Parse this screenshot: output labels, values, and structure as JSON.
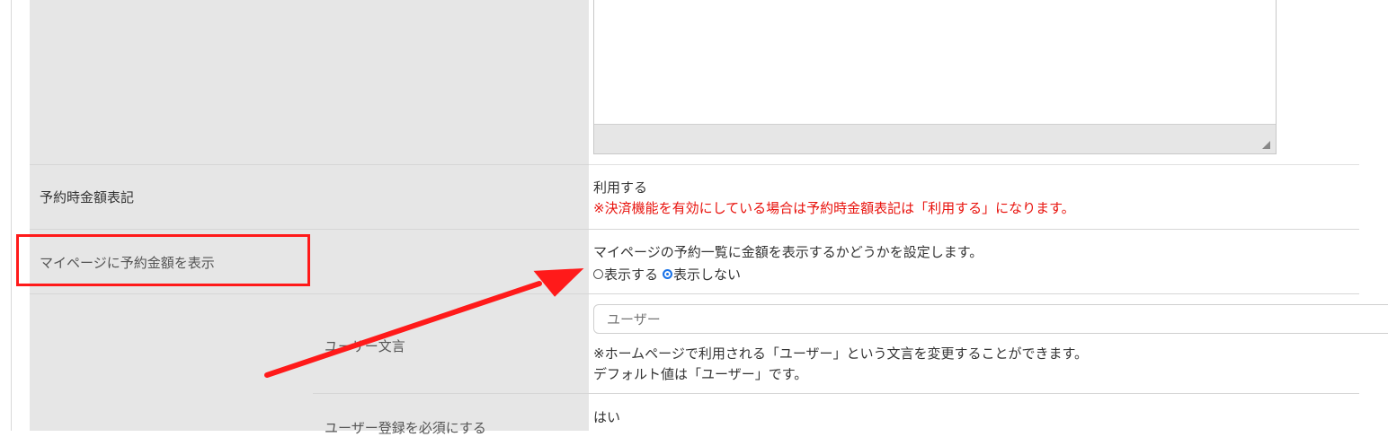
{
  "rows": {
    "price_display": {
      "label": "予約時金額表記",
      "value": "利用する",
      "note": "※決済機能を有効にしている場合は予約時金額表記は「利用する」になります。"
    },
    "mypage_price": {
      "label": "マイページに予約金額を表示",
      "description": "マイページの予約一覧に金額を表示するかどうかを設定します。",
      "options": [
        {
          "label": "表示する",
          "selected": false
        },
        {
          "label": "表示しない",
          "selected": true
        }
      ]
    },
    "user_wording": {
      "label": "ユーザー文言",
      "input_placeholder": "ユーザー",
      "note1": "※ホームページで利用される「ユーザー」という文言を変更することができます。",
      "note2": "デフォルト値は「ユーザー」です。"
    },
    "user_required": {
      "label": "ユーザー登録を必須にする",
      "value": "はい"
    }
  },
  "colors": {
    "label_bg": "#e6e6e6",
    "annotation_red": "#ff1a1a",
    "note_red": "#e8120c",
    "radio_accent": "#1a73e8"
  }
}
